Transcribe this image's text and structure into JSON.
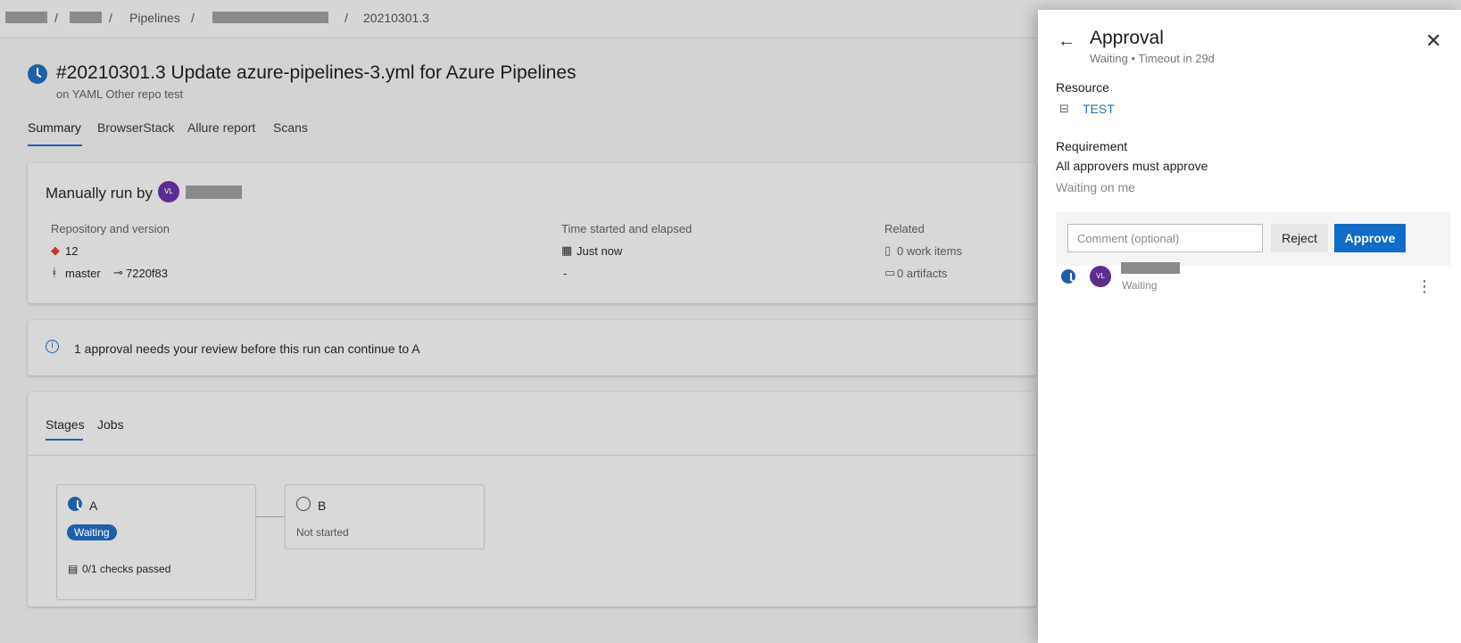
{
  "breadcrumb": {
    "sep": "/",
    "pipelines": "Pipelines",
    "run": "20210301.3"
  },
  "run": {
    "title": "#20210301.3 Update azure-pipelines-3.yml for Azure Pipelines",
    "subtitle": "on YAML Other repo test"
  },
  "tabs": [
    "Summary",
    "BrowserStack",
    "Allure report",
    "Scans"
  ],
  "summary": {
    "manually_run_by": "Manually run by",
    "avatar_initials": "VL",
    "repo_label": "Repository and version",
    "repo_count": "12",
    "branch": "master",
    "commit": "7220f83",
    "time_label": "Time started and elapsed",
    "time_value": "Just now",
    "elapsed": "-",
    "related_label": "Related",
    "work_items": "0 work items",
    "artifacts": "0 artifacts"
  },
  "info_banner": "1 approval needs your review before this run can continue to A",
  "stages_tabs": [
    "Stages",
    "Jobs"
  ],
  "stages": [
    {
      "name": "A",
      "status": "Waiting",
      "checks": "0/1 checks passed"
    },
    {
      "name": "B",
      "status": "Not started"
    }
  ],
  "panel": {
    "title": "Approval",
    "subtitle": "Waiting • Timeout in 29d",
    "resource_header": "Resource",
    "resource_link": "TEST",
    "requirement_header": "Requirement",
    "requirement_text": "All approvers must approve",
    "waiting_on": "Waiting on me",
    "comment_placeholder": "Comment (optional)",
    "reject_label": "Reject",
    "approve_label": "Approve",
    "approver_initials": "VL",
    "approver_status": "Waiting"
  }
}
